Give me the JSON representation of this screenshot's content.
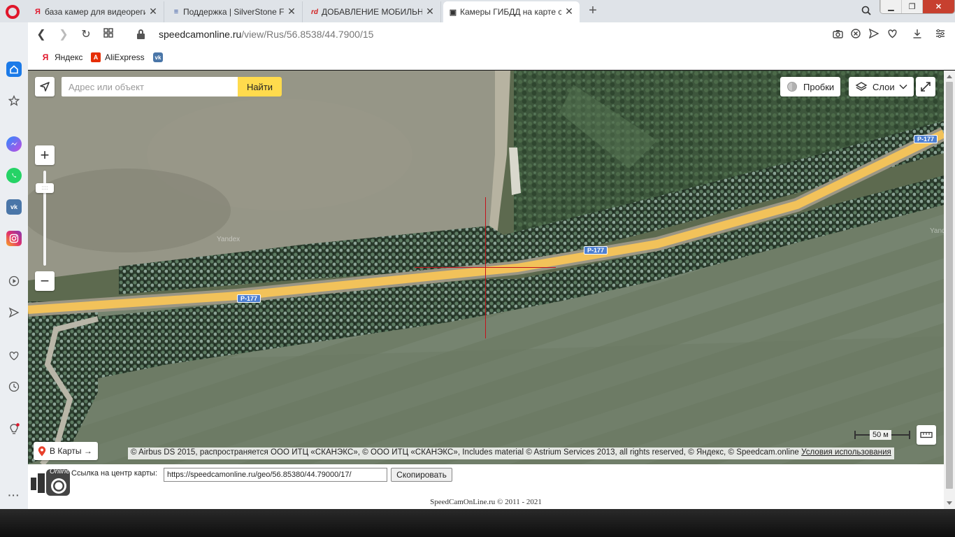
{
  "browser": {
    "tabs": [
      {
        "title": "база камер для видеорегистр",
        "favicon": "yandex-icon",
        "favicon_glyph": "Я",
        "favicon_color": "#e0162b"
      },
      {
        "title": "Поддержка | SilverStone F",
        "favicon": "silverstone-icon",
        "favicon_glyph": "≡",
        "favicon_color": "#3050a0"
      },
      {
        "title": "ДОБАВЛЕНИЕ МОБИЛЬНЫХ",
        "favicon": "rd-icon",
        "favicon_glyph": "rd",
        "favicon_color": "#d22222"
      },
      {
        "title": "Камеры ГИБДД на карте с",
        "favicon": "speedcam-icon",
        "favicon_glyph": "▣",
        "favicon_color": "#333333",
        "active": true
      }
    ],
    "new_tab": "+",
    "url": {
      "host": "speedcamonline.ru",
      "path": "/view/Rus/56.8538/44.7900/15"
    },
    "bookmarks": [
      {
        "label": "Яндекс",
        "icon": "yandex-icon",
        "glyph": "Я",
        "color": "#e0162b"
      },
      {
        "label": "AliExpress",
        "icon": "aliexpress-icon",
        "glyph": "A",
        "color": "#e62e04"
      },
      {
        "label": "",
        "icon": "vk-icon",
        "glyph": "vk",
        "color": "#4a76a8"
      }
    ],
    "sidebar_icons": [
      "home-icon",
      "star-icon",
      "messenger-icon",
      "whatsapp-icon",
      "vk-icon",
      "instagram-icon",
      "player-icon",
      "send-icon",
      "heart-icon",
      "history-icon",
      "lightbulb-icon",
      "more-icon"
    ]
  },
  "map": {
    "search_placeholder": "Адрес или объект",
    "find_button": "Найти",
    "traffic_button": "Пробки",
    "layers_button": "Слои",
    "zoom_in": "+",
    "zoom_out": "−",
    "zoom_level": 0.85,
    "road_badges": [
      "Р-177",
      "Р-177",
      "Р-177"
    ],
    "watermark": "Yandex",
    "to_maps_button": "В Карты →",
    "copyright": "© Airbus DS 2015, распространяется ООО ИТЦ «СКАНЭКС», © ООО ИТЦ «СКАНЭКС», Includes material © Astrium Services 2013, all rights reserved, © Яндекс, © Speedcam.online",
    "terms_link": "Условия использования",
    "scale_label": "50 м",
    "colors": {
      "road": "#f2c25a",
      "field": "#8e8f7c",
      "forest": "#3e5a3c",
      "crosshair": "#c4121b"
    }
  },
  "page": {
    "logo_text": "Online",
    "link_label": "Ссылка на центр карты:",
    "link_value": "https://speedcamonline.ru/geo/56.85380/44.79000/17/",
    "copy_button": "Скопировать",
    "footer": "SpeedCamOnLine.ru © 2011 - 2021"
  }
}
